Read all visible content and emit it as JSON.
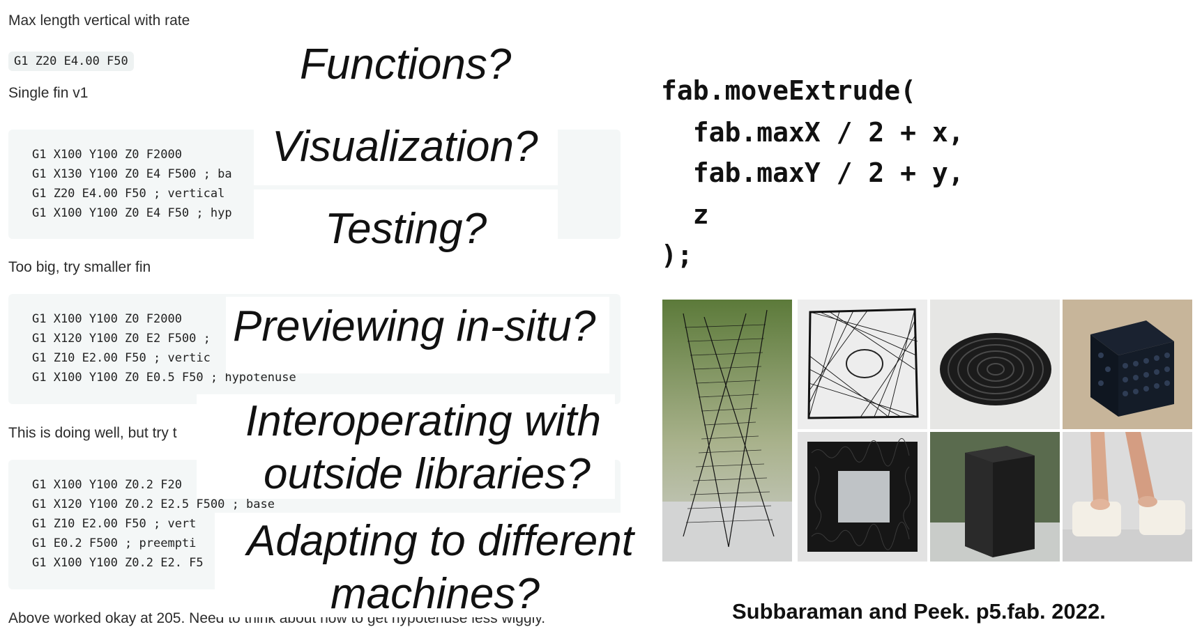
{
  "notebook": {
    "heading_1": "Max length vertical with rate",
    "inline_code": "G1 Z20 E4.00 F50",
    "heading_2": "Single fin v1",
    "block_1": [
      "G1 X100 Y100 Z0 F2000",
      "G1 X130 Y100 Z0 E4 F500 ; ba",
      "G1 Z20 E4.00 F50 ; vertical",
      "G1 X100 Y100 Z0 E4 F50 ; hyp"
    ],
    "heading_3": "Too big, try smaller fin",
    "block_2": [
      "G1 X100 Y100 Z0 F2000",
      "G1 X120 Y100 Z0 E2 F500 ;",
      "G1 Z10 E2.00 F50 ; vertic",
      "G1 X100 Y100 Z0 E0.5 F50 ; hypotenuse"
    ],
    "heading_4": "This is doing well, but try t",
    "block_3": [
      "G1 X100 Y100 Z0.2 F20",
      "G1 X120 Y100 Z0.2 E2.5 F500 ; base",
      "G1 Z10 E2.00 F50 ; vert",
      "G1 E0.2 F500 ; preempti",
      "G1 X100 Y100 Z0.2 E2. F5"
    ],
    "footer": "Above worked okay at 205. Need to think about how to get hypotenuse less wiggly."
  },
  "questions": [
    "Functions?",
    "Visualization?",
    "Testing?",
    "Previewing in-situ?",
    "Interoperating with",
    "outside libraries?",
    "Adapting to different",
    "machines?"
  ],
  "code": {
    "lines": [
      "fab.moveExtrude(",
      "  fab.maxX / 2 + x,",
      "  fab.maxY / 2 + y,",
      "  z",
      ");"
    ]
  },
  "photos": [
    {
      "name": "twisted-tower-photo"
    },
    {
      "name": "string-square-photo"
    },
    {
      "name": "spiral-coil-photo"
    },
    {
      "name": "bead-cube-photo"
    },
    {
      "name": "hollow-square-photo"
    },
    {
      "name": "black-block-photo"
    },
    {
      "name": "white-foam-photo"
    }
  ],
  "citation": "Subbaraman and Peek. p5.fab. 2022.",
  "colors": {
    "code_bg": "#f4f7f7",
    "inline_code_bg": "#eef2f2",
    "text": "#2b2b2b"
  }
}
